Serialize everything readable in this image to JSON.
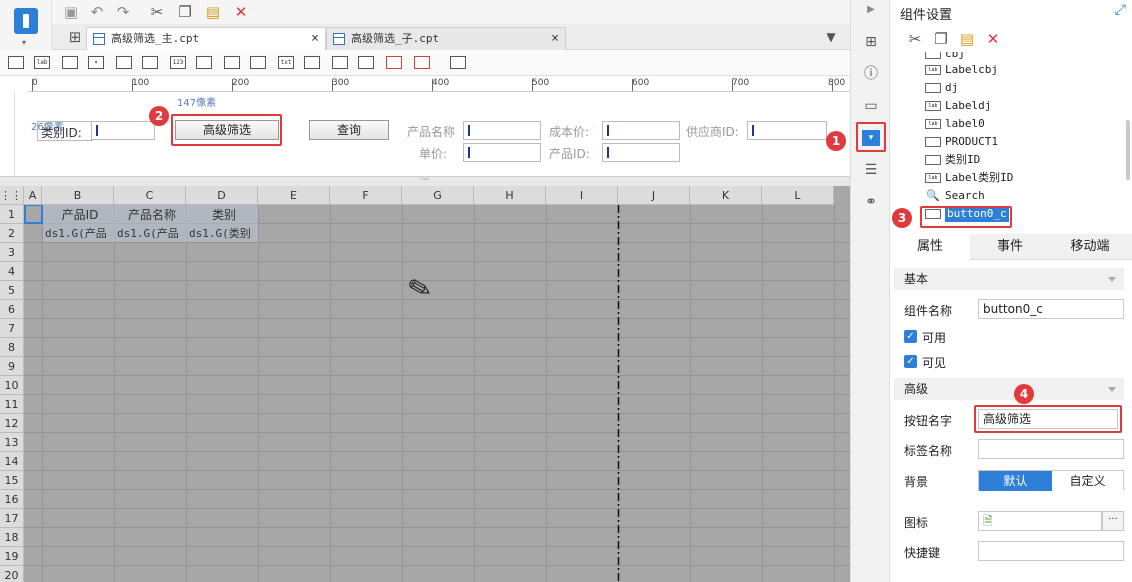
{
  "toolbar": {
    "save_icon": "save-icon",
    "undo_icon": "undo-icon",
    "redo_icon": "redo-icon",
    "cut_icon": "cut-icon",
    "copy_icon": "copy-icon",
    "paste_icon": "paste-icon",
    "delete_icon": "delete-icon"
  },
  "tabs": [
    {
      "label": "高级筛选_主.cpt",
      "close": "×"
    },
    {
      "label": "高级筛选_子.cpt",
      "close": "×"
    }
  ],
  "widget_toolbar": [
    "lab",
    "123",
    "txt"
  ],
  "ruler": {
    "ticks": [
      "0",
      "100",
      "200",
      "300",
      "400",
      "500",
      "600",
      "700",
      "800"
    ],
    "width_hint": "147像素",
    "height_hint": "26像素"
  },
  "form": {
    "category_label": "类别ID:",
    "advanced_button": "高级筛选",
    "query_button": "查询",
    "product_name_label": "产品名称",
    "cost_label": "成本价:",
    "supplier_label": "供应商ID:",
    "unit_price_label": "单价:",
    "product_id_label": "产品ID:"
  },
  "splitter": "···",
  "grid": {
    "columns": [
      "A",
      "B",
      "C",
      "D",
      "E",
      "F",
      "G",
      "H",
      "I",
      "J",
      "K",
      "L"
    ],
    "rows": [
      "1",
      "2",
      "3",
      "4",
      "5",
      "6",
      "7",
      "8",
      "9",
      "10",
      "11",
      "12",
      "13",
      "14",
      "15",
      "16",
      "17",
      "18",
      "19",
      "20"
    ],
    "header_cells": [
      "产品ID",
      "产品名称",
      "类别"
    ],
    "data_cells": [
      "ds1.G(产品",
      "ds1.G(产品",
      "ds1.G(类别"
    ]
  },
  "panel": {
    "title": "组件设置",
    "tree": [
      {
        "icon": "",
        "label": "cbj"
      },
      {
        "icon": "lab",
        "label": "Labelcbj"
      },
      {
        "icon": "",
        "label": "dj"
      },
      {
        "icon": "lab",
        "label": "Labeldj"
      },
      {
        "icon": "lab",
        "label": "label0"
      },
      {
        "icon": "",
        "label": "PRODUCT1"
      },
      {
        "icon": "",
        "label": "类别ID"
      },
      {
        "icon": "lab",
        "label": "Label类别ID"
      },
      {
        "icon": "",
        "label": "Search"
      },
      {
        "icon": "",
        "label": "button0_c"
      }
    ],
    "tabs": [
      "属性",
      "事件",
      "移动端"
    ],
    "basic_section": "基本",
    "component_name_label": "组件名称",
    "component_name_value": "button0_c",
    "enabled_label": "可用",
    "visible_label": "可见",
    "advanced_section": "高级",
    "button_name_label": "按钮名字",
    "button_name_value": "高级筛选",
    "tag_name_label": "标签名称",
    "tag_name_value": "",
    "background_label": "背景",
    "bg_default": "默认",
    "bg_custom": "自定义",
    "icon_label": "图标",
    "icon_more": "···",
    "shortcut_label": "快捷键",
    "shortcut_value": ""
  },
  "badges": [
    "1",
    "2",
    "3",
    "4"
  ],
  "colors": {
    "accent": "#2d7fd8",
    "annotation_red": "#e0393e",
    "grid_bg": "#a7a7a7"
  }
}
